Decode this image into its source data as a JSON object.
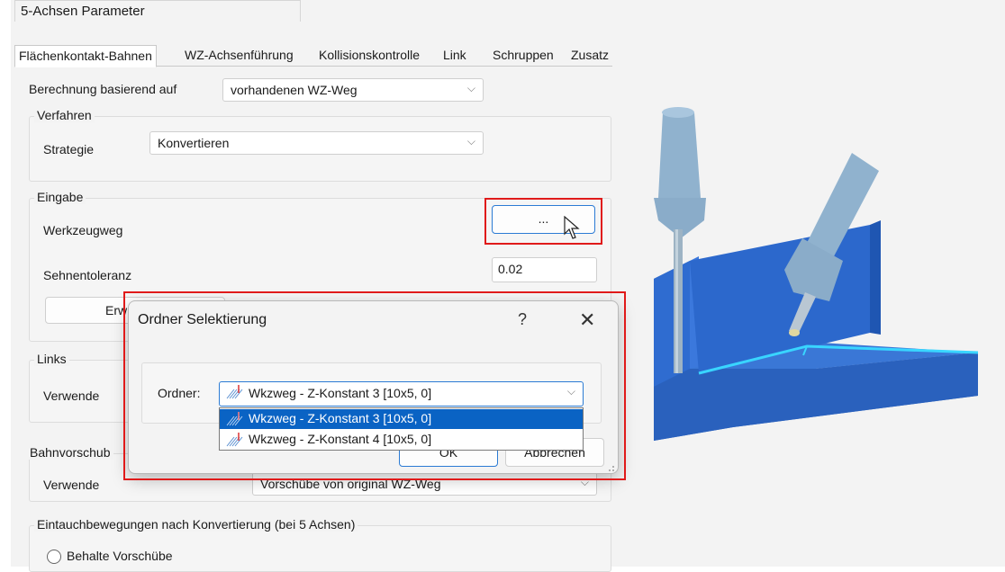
{
  "window": {
    "title": "5-Achsen Parameter"
  },
  "tabs": [
    {
      "label": "Flächenkontakt-Bahnen"
    },
    {
      "label": "WZ-Achsenführung"
    },
    {
      "label": "Kollisionskontrolle"
    },
    {
      "label": "Link"
    },
    {
      "label": "Schruppen"
    },
    {
      "label": "Zusatz"
    }
  ],
  "berechnung": {
    "label": "Berechnung basierend auf",
    "value": "vorhandenen WZ-Weg"
  },
  "verfahren": {
    "legend": "Verfahren",
    "strategie_label": "Strategie",
    "strategie_value": "Konvertieren"
  },
  "eingabe": {
    "legend": "Eingabe",
    "werkzeugweg_label": "Werkzeugweg",
    "browse_label": "...",
    "sehnentoleranz_label": "Sehnentoleranz",
    "sehnentoleranz_value": "0.02",
    "erweitert_label": "Erw"
  },
  "links": {
    "legend": "Links",
    "verwende_label": "Verwende"
  },
  "bahnvorschub": {
    "legend": "Bahnvorschub",
    "verwende_label": "Verwende",
    "value": "Vorschübe von original WZ-Weg"
  },
  "eintauch": {
    "legend": "Eintauchbewegungen nach Konvertierung (bei 5 Achsen)",
    "radio_label": "Behalte Vorschübe"
  },
  "dialog": {
    "title": "Ordner Selektierung",
    "help": "?",
    "close": "✕",
    "ordner_label": "Ordner:",
    "ordner_value": "Wkzweg - Z-Konstant 3 [10x5, 0]",
    "options": [
      "Wkzweg - Z-Konstant 3 [10x5, 0]",
      "Wkzweg - Z-Konstant 4 [10x5, 0]"
    ],
    "ok_label": "OK",
    "cancel_label": "Abbrechen"
  },
  "colors": {
    "highlight": "#e01a1a",
    "selection": "#0a63c4",
    "part": "#2c67c9",
    "tool": "#8fb1cc"
  },
  "icons": {
    "chevron": "chevron-down-icon",
    "toolpath": "toolpath-icon"
  }
}
